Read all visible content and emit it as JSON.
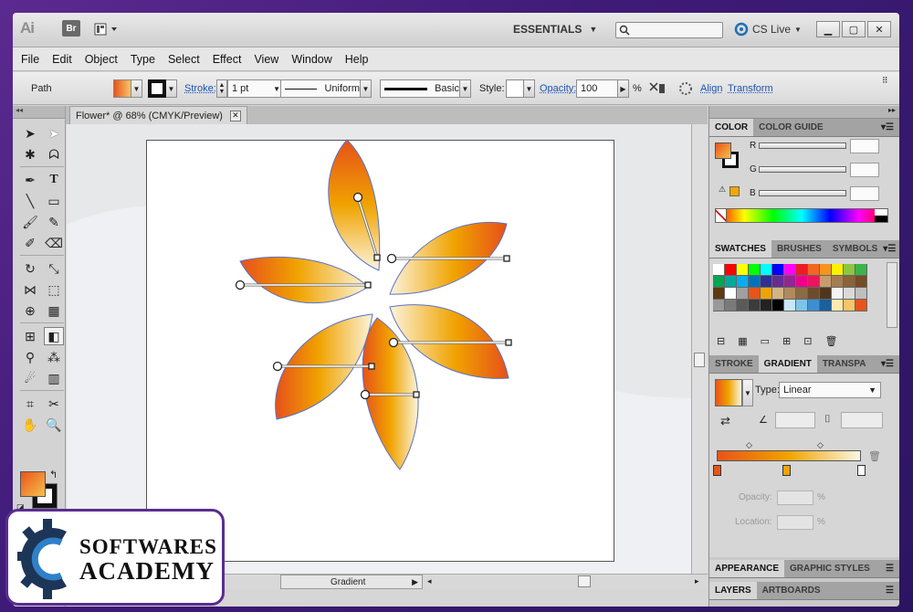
{
  "app": {
    "logo": "Ai",
    "bridge": "Br",
    "workspace": "ESSENTIALS",
    "cs_live": "CS Live",
    "search_placeholder": ""
  },
  "menu": [
    "File",
    "Edit",
    "Object",
    "Type",
    "Select",
    "Effect",
    "View",
    "Window",
    "Help"
  ],
  "control": {
    "selection": "Path",
    "stroke_label": "Stroke:",
    "stroke_weight": "1 pt",
    "profile": "Uniform",
    "brush": "Basic",
    "style_label": "Style:",
    "opacity_label": "Opacity:",
    "opacity": "100",
    "percent": "%",
    "align": "Align",
    "transform": "Transform"
  },
  "document": {
    "tab": "Flower* @ 68% (CMYK/Preview)"
  },
  "status": {
    "gradient": "Gradient"
  },
  "panels": {
    "color": {
      "tabs": [
        "COLOR",
        "COLOR GUIDE"
      ],
      "r": "R",
      "g": "G",
      "b": "B"
    },
    "swatches": {
      "tabs": [
        "SWATCHES",
        "BRUSHES",
        "SYMBOLS"
      ]
    },
    "gradient": {
      "tabs": [
        "STROKE",
        "GRADIENT",
        "TRANSPA"
      ],
      "type_label": "Type:",
      "type": "Linear",
      "opacity_label": "Opacity:",
      "location_label": "Location:",
      "percent": "%"
    },
    "appearance": {
      "tabs": [
        "APPEARANCE",
        "GRAPHIC STYLES"
      ]
    },
    "layers": {
      "tabs": [
        "LAYERS",
        "ARTBOARDS"
      ]
    }
  },
  "colors": {
    "gradient_start": "#e8541a",
    "gradient_mid": "#f0a400",
    "gradient_end": "#faf6e4",
    "accent_link": "#1d53b6",
    "brand_purple": "#5a2d91"
  },
  "watermark": {
    "line1": "SOFTWARES",
    "line2": "ACADEMY"
  }
}
